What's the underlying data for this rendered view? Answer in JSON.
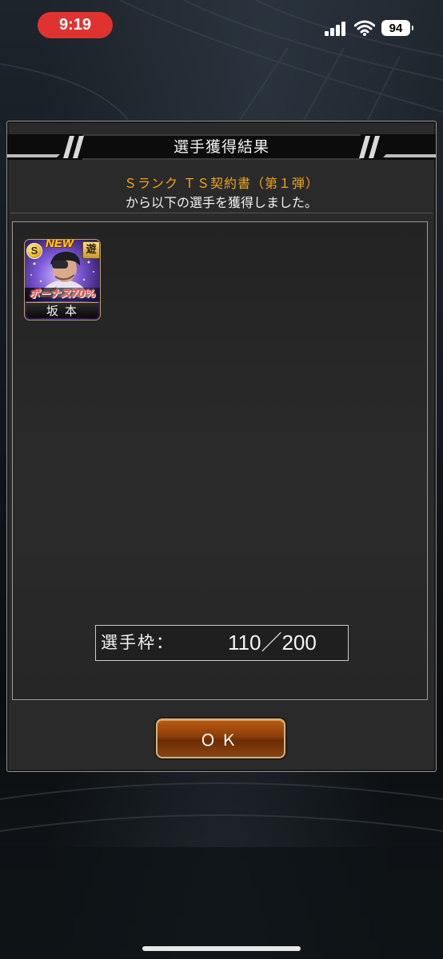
{
  "status_bar": {
    "time": "9:19",
    "battery": "94",
    "icons": [
      "signal-icon",
      "wifi-icon",
      "battery-icon"
    ]
  },
  "dialog": {
    "title": "選手獲得結果",
    "subtitle_line1": "Ｓランク ＴＳ契約書（第１弾）",
    "subtitle_line2": "から以下の選手を獲得しました。"
  },
  "player_card": {
    "rank": "S",
    "new_label": "NEW",
    "position": "遊",
    "bonus": "ボーナス70%",
    "name": "坂本"
  },
  "roster": {
    "label": "選手枠：",
    "value": "110／200"
  },
  "ok_button": {
    "label": "ＯＫ"
  },
  "colors": {
    "gold_text": "#f0a41b",
    "ok_button": "#8c3e08",
    "time_pill": "#e0332f",
    "card_purple": "#7e5ad8"
  }
}
